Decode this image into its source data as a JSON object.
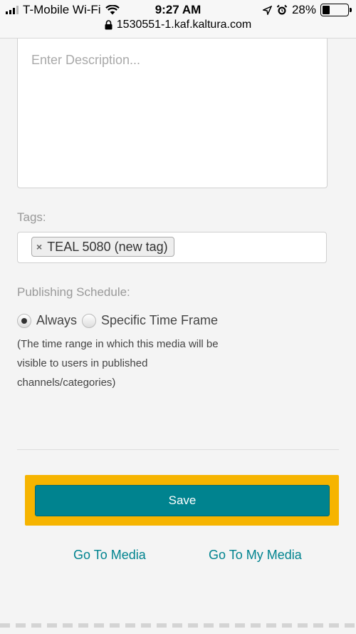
{
  "status_bar": {
    "carrier": "T-Mobile Wi-Fi",
    "time": "9:27 AM",
    "battery_pct": "28%",
    "battery_level": 0.28,
    "url": "1530551-1.kaf.kaltura.com"
  },
  "form": {
    "description": {
      "placeholder": "Enter Description...",
      "value": ""
    },
    "tags": {
      "label": "Tags:",
      "items": [
        {
          "remove": "×",
          "text": "TEAL 5080 (new tag)"
        }
      ]
    },
    "schedule": {
      "label": "Publishing Schedule:",
      "options": [
        {
          "label": "Always",
          "selected": true
        },
        {
          "label": "Specific Time Frame",
          "selected": false
        }
      ],
      "help": "(The time range in which this media will be visible to users in published channels/categories)"
    },
    "save_label": "Save",
    "links": {
      "go_to_media": "Go To Media",
      "go_to_my_media": "Go To My Media"
    }
  },
  "colors": {
    "accent": "#00838f",
    "highlight": "#f6b400"
  }
}
